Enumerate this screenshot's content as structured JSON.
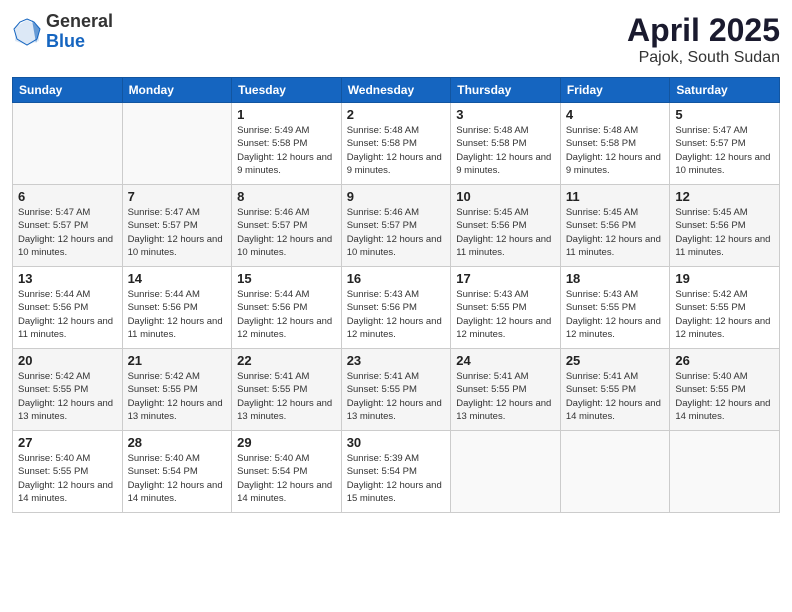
{
  "header": {
    "logo_general": "General",
    "logo_blue": "Blue",
    "month_title": "April 2025",
    "location": "Pajok, South Sudan"
  },
  "weekdays": [
    "Sunday",
    "Monday",
    "Tuesday",
    "Wednesday",
    "Thursday",
    "Friday",
    "Saturday"
  ],
  "weeks": [
    [
      {
        "day": "",
        "info": ""
      },
      {
        "day": "",
        "info": ""
      },
      {
        "day": "1",
        "info": "Sunrise: 5:49 AM\nSunset: 5:58 PM\nDaylight: 12 hours\nand 9 minutes."
      },
      {
        "day": "2",
        "info": "Sunrise: 5:48 AM\nSunset: 5:58 PM\nDaylight: 12 hours\nand 9 minutes."
      },
      {
        "day": "3",
        "info": "Sunrise: 5:48 AM\nSunset: 5:58 PM\nDaylight: 12 hours\nand 9 minutes."
      },
      {
        "day": "4",
        "info": "Sunrise: 5:48 AM\nSunset: 5:58 PM\nDaylight: 12 hours\nand 9 minutes."
      },
      {
        "day": "5",
        "info": "Sunrise: 5:47 AM\nSunset: 5:57 PM\nDaylight: 12 hours\nand 10 minutes."
      }
    ],
    [
      {
        "day": "6",
        "info": "Sunrise: 5:47 AM\nSunset: 5:57 PM\nDaylight: 12 hours\nand 10 minutes."
      },
      {
        "day": "7",
        "info": "Sunrise: 5:47 AM\nSunset: 5:57 PM\nDaylight: 12 hours\nand 10 minutes."
      },
      {
        "day": "8",
        "info": "Sunrise: 5:46 AM\nSunset: 5:57 PM\nDaylight: 12 hours\nand 10 minutes."
      },
      {
        "day": "9",
        "info": "Sunrise: 5:46 AM\nSunset: 5:57 PM\nDaylight: 12 hours\nand 10 minutes."
      },
      {
        "day": "10",
        "info": "Sunrise: 5:45 AM\nSunset: 5:56 PM\nDaylight: 12 hours\nand 11 minutes."
      },
      {
        "day": "11",
        "info": "Sunrise: 5:45 AM\nSunset: 5:56 PM\nDaylight: 12 hours\nand 11 minutes."
      },
      {
        "day": "12",
        "info": "Sunrise: 5:45 AM\nSunset: 5:56 PM\nDaylight: 12 hours\nand 11 minutes."
      }
    ],
    [
      {
        "day": "13",
        "info": "Sunrise: 5:44 AM\nSunset: 5:56 PM\nDaylight: 12 hours\nand 11 minutes."
      },
      {
        "day": "14",
        "info": "Sunrise: 5:44 AM\nSunset: 5:56 PM\nDaylight: 12 hours\nand 11 minutes."
      },
      {
        "day": "15",
        "info": "Sunrise: 5:44 AM\nSunset: 5:56 PM\nDaylight: 12 hours\nand 12 minutes."
      },
      {
        "day": "16",
        "info": "Sunrise: 5:43 AM\nSunset: 5:56 PM\nDaylight: 12 hours\nand 12 minutes."
      },
      {
        "day": "17",
        "info": "Sunrise: 5:43 AM\nSunset: 5:55 PM\nDaylight: 12 hours\nand 12 minutes."
      },
      {
        "day": "18",
        "info": "Sunrise: 5:43 AM\nSunset: 5:55 PM\nDaylight: 12 hours\nand 12 minutes."
      },
      {
        "day": "19",
        "info": "Sunrise: 5:42 AM\nSunset: 5:55 PM\nDaylight: 12 hours\nand 12 minutes."
      }
    ],
    [
      {
        "day": "20",
        "info": "Sunrise: 5:42 AM\nSunset: 5:55 PM\nDaylight: 12 hours\nand 13 minutes."
      },
      {
        "day": "21",
        "info": "Sunrise: 5:42 AM\nSunset: 5:55 PM\nDaylight: 12 hours\nand 13 minutes."
      },
      {
        "day": "22",
        "info": "Sunrise: 5:41 AM\nSunset: 5:55 PM\nDaylight: 12 hours\nand 13 minutes."
      },
      {
        "day": "23",
        "info": "Sunrise: 5:41 AM\nSunset: 5:55 PM\nDaylight: 12 hours\nand 13 minutes."
      },
      {
        "day": "24",
        "info": "Sunrise: 5:41 AM\nSunset: 5:55 PM\nDaylight: 12 hours\nand 13 minutes."
      },
      {
        "day": "25",
        "info": "Sunrise: 5:41 AM\nSunset: 5:55 PM\nDaylight: 12 hours\nand 14 minutes."
      },
      {
        "day": "26",
        "info": "Sunrise: 5:40 AM\nSunset: 5:55 PM\nDaylight: 12 hours\nand 14 minutes."
      }
    ],
    [
      {
        "day": "27",
        "info": "Sunrise: 5:40 AM\nSunset: 5:55 PM\nDaylight: 12 hours\nand 14 minutes."
      },
      {
        "day": "28",
        "info": "Sunrise: 5:40 AM\nSunset: 5:54 PM\nDaylight: 12 hours\nand 14 minutes."
      },
      {
        "day": "29",
        "info": "Sunrise: 5:40 AM\nSunset: 5:54 PM\nDaylight: 12 hours\nand 14 minutes."
      },
      {
        "day": "30",
        "info": "Sunrise: 5:39 AM\nSunset: 5:54 PM\nDaylight: 12 hours\nand 15 minutes."
      },
      {
        "day": "",
        "info": ""
      },
      {
        "day": "",
        "info": ""
      },
      {
        "day": "",
        "info": ""
      }
    ]
  ]
}
